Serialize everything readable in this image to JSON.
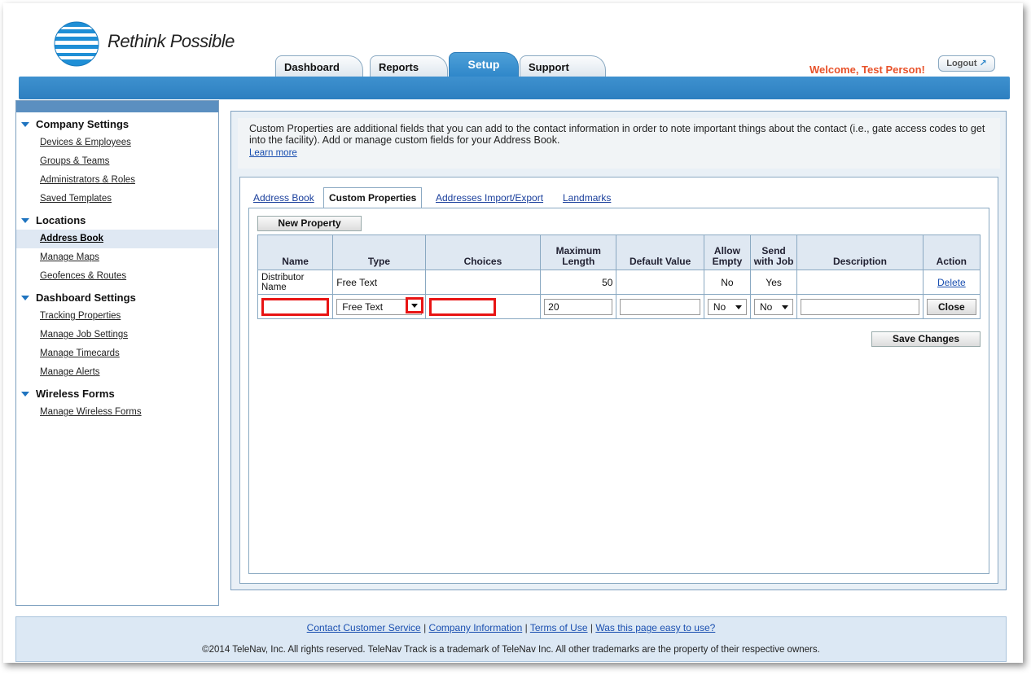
{
  "brand": {
    "tagline": "Rethink Possible"
  },
  "top_tabs": [
    {
      "label": "Dashboard"
    },
    {
      "label": "Reports"
    },
    {
      "label": "Setup"
    },
    {
      "label": "Support"
    }
  ],
  "user": {
    "welcome": "Welcome, Test Person!",
    "logout": "Logout"
  },
  "sidebar": {
    "sections": [
      {
        "title": "Company Settings",
        "items": [
          "Devices & Employees",
          "Groups & Teams",
          "Administrators & Roles",
          "Saved Templates"
        ]
      },
      {
        "title": "Locations",
        "items": [
          "Address Book",
          "Manage Maps",
          "Geofences & Routes"
        ]
      },
      {
        "title": "Dashboard Settings",
        "items": [
          "Tracking Properties",
          "Manage Job Settings",
          "Manage Timecards",
          "Manage Alerts"
        ]
      },
      {
        "title": "Wireless Forms",
        "items": [
          "Manage Wireless Forms"
        ]
      }
    ],
    "active_item": "Address Book"
  },
  "intro": {
    "text": "Custom Properties are additional fields that you can add to the contact information in order to note important things about the contact (i.e., gate access codes to get into the facility). Add or manage custom fields for your Address Book.",
    "learn_more": "Learn more"
  },
  "sub_tabs": [
    "Address Book",
    "Custom Properties",
    "Addresses Import/Export",
    "Landmarks"
  ],
  "buttons": {
    "new_property": "New Property",
    "save_changes": "Save Changes",
    "close": "Close"
  },
  "table": {
    "headers": {
      "name": "Name",
      "type": "Type",
      "choices": "Choices",
      "max_length": "Maximum Length",
      "default_value": "Default Value",
      "allow_empty": "Allow Empty",
      "send_with_job": "Send with Job",
      "description": "Description",
      "action": "Action"
    },
    "rows": [
      {
        "name": "Distributor Name",
        "type": "Free Text",
        "choices": "",
        "max_length": "50",
        "default_value": "",
        "allow_empty": "No",
        "send_with_job": "Yes",
        "description": "",
        "action": "Delete"
      }
    ],
    "edit_row": {
      "name": "",
      "type": "Free Text",
      "choices": "",
      "max_length": "20",
      "default_value": "",
      "allow_empty": "No",
      "send_with_job": "No",
      "description": ""
    }
  },
  "footer": {
    "links": [
      "Contact Customer Service",
      "Company Information",
      "Terms of Use",
      "Was this page easy to use?"
    ],
    "copyright": "©2014 TeleNav, Inc. All rights reserved. TeleNav Track is a trademark of TeleNav Inc. All other trademarks are the property of their respective owners."
  },
  "colors": {
    "accent_blue": "#2e86c9",
    "welcome_orange": "#e8522a",
    "highlight_red": "#e81414"
  }
}
